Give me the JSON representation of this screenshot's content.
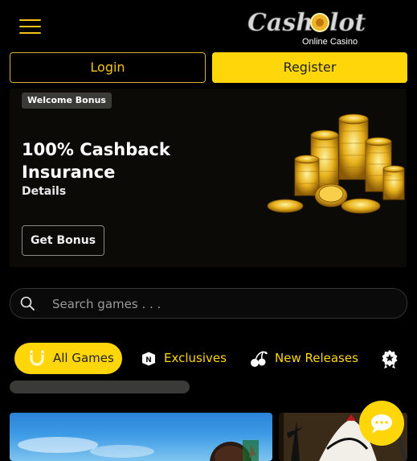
{
  "header": {
    "logo_text": "Cash lot",
    "logo_subtitle": "Online Casino",
    "menu_icon": "hamburger-menu-icon"
  },
  "auth": {
    "login_label": "Login",
    "register_label": "Register"
  },
  "promo": {
    "badge": "Welcome Bonus",
    "title": "100% Cashback Insurance",
    "details_label": "Details",
    "cta_label": "Get Bonus"
  },
  "search": {
    "placeholder": "Search games . . ."
  },
  "categories": {
    "tabs": [
      {
        "label": "All Games",
        "icon": "horseshoe-icon",
        "active": true
      },
      {
        "label": "Exclusives",
        "icon": "exclusives-icon"
      },
      {
        "label": "New Releases",
        "icon": "cherries-icon"
      },
      {
        "label": "",
        "icon": "award-icon"
      }
    ]
  },
  "colors": {
    "accent": "#ffd60a",
    "background": "#000000",
    "banner_bg": "#0b0a07",
    "text": "#ffffff"
  },
  "chat": {
    "icon": "chat-bubble-icon"
  }
}
